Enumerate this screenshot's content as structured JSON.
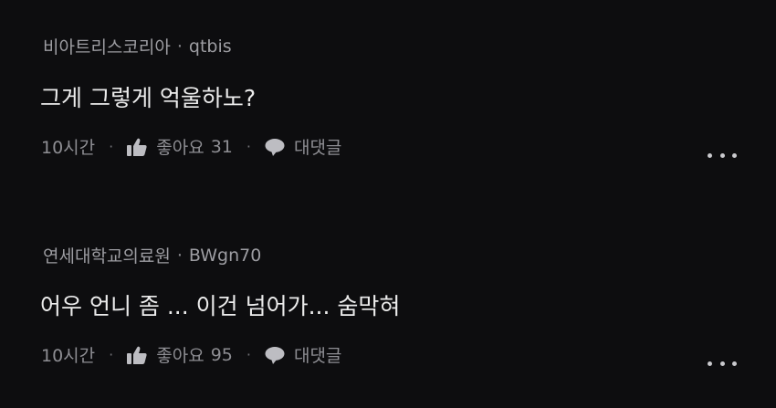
{
  "comments": [
    {
      "school": "비아트리스코리아",
      "separator": "·",
      "user": "qtbis",
      "text": "그게 그렇게 억울하노?",
      "time": "10시간",
      "like_label": "좋아요",
      "like_count": "31",
      "reply_label": "대댓글"
    },
    {
      "school": "연세대학교의료원",
      "separator": "·",
      "user": "BWgn70",
      "text": "어우 언니 좀 ... 이건 넘어가... 숨막혀",
      "time": "10시간",
      "like_label": "좋아요",
      "like_count": "95",
      "reply_label": "대댓글"
    }
  ],
  "meta_separator": "·",
  "icons": {
    "like": "thumbs-up-icon",
    "reply": "speech-bubble-icon",
    "more": "more-horizontal-icon"
  },
  "colors": {
    "background": "#0d0d0f",
    "text_primary": "#ececec",
    "text_secondary": "#9d9da2"
  }
}
